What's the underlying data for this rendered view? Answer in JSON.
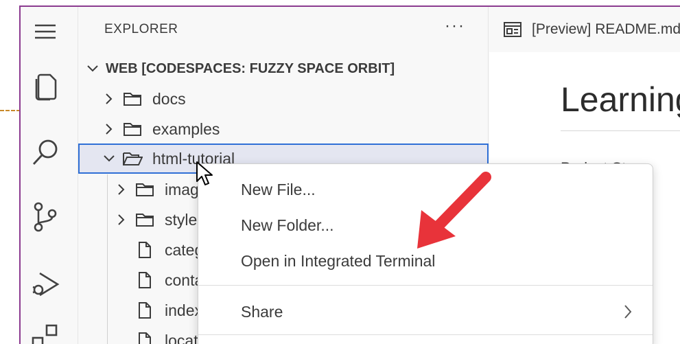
{
  "sidebar": {
    "title": "EXPLORER",
    "more_actions": "···",
    "workspace": "WEB [CODESPACES: FUZZY SPACE ORBIT]",
    "items": [
      {
        "label": "docs",
        "type": "folder",
        "expanded": false
      },
      {
        "label": "examples",
        "type": "folder",
        "expanded": false
      },
      {
        "label": "html-tutorial",
        "type": "folder",
        "expanded": true,
        "selected": true
      },
      {
        "label": "images",
        "type": "folder",
        "expanded": false
      },
      {
        "label": "styles",
        "type": "folder",
        "expanded": false
      },
      {
        "label": "categories.html",
        "type": "file"
      },
      {
        "label": "contact.html",
        "type": "file"
      },
      {
        "label": "index.html",
        "type": "file"
      },
      {
        "label": "locations.html",
        "type": "file"
      }
    ]
  },
  "editor": {
    "tab_label": "[Preview] README.md",
    "heading": "Learning",
    "paragraph": "Project Steps"
  },
  "context_menu": {
    "items": [
      {
        "label": "New File..."
      },
      {
        "label": "New Folder..."
      },
      {
        "label": "Open in Integrated Terminal"
      },
      {
        "label": "Share"
      }
    ]
  },
  "colors": {
    "frame": "#8b3a8f",
    "selection_border": "#2f6fd6",
    "annotation_arrow": "#e8333a"
  }
}
